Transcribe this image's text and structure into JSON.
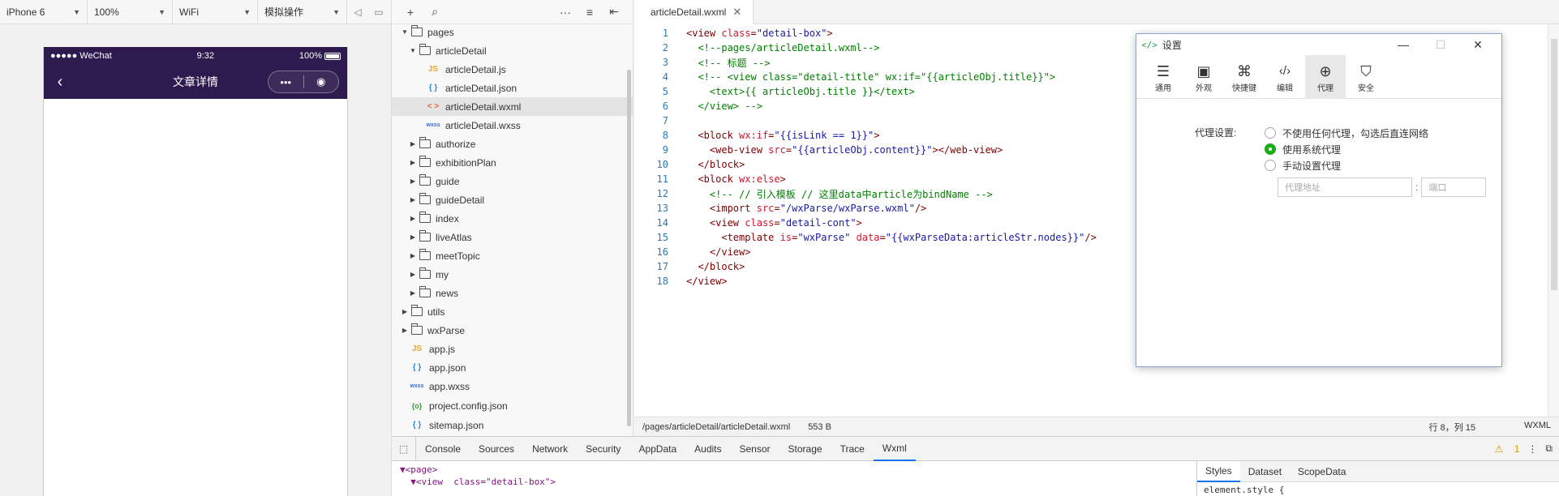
{
  "simulator": {
    "device": "iPhone 6",
    "zoom": "100%",
    "network": "WiFi",
    "mode": "模拟操作",
    "status": {
      "carrier": "●●●●● WeChat",
      "time": "9:32",
      "battery": "100%"
    },
    "nav_title": "文章详情"
  },
  "tree": {
    "rows": [
      {
        "label": "pages"
      },
      {
        "label": "articleDetail"
      },
      {
        "label": "articleDetail.js",
        "icon": "JS"
      },
      {
        "label": "articleDetail.json",
        "icon": "{ }"
      },
      {
        "label": "articleDetail.wxml",
        "icon": "< >"
      },
      {
        "label": "articleDetail.wxss",
        "icon": "wxss"
      },
      {
        "label": "authorize"
      },
      {
        "label": "exhibitionPlan"
      },
      {
        "label": "guide"
      },
      {
        "label": "guideDetail"
      },
      {
        "label": "index"
      },
      {
        "label": "liveAtlas"
      },
      {
        "label": "meetTopic"
      },
      {
        "label": "my"
      },
      {
        "label": "news"
      },
      {
        "label": "utils"
      },
      {
        "label": "wxParse"
      },
      {
        "label": "app.js",
        "icon": "JS"
      },
      {
        "label": "app.json",
        "icon": "{ }"
      },
      {
        "label": "app.wxss",
        "icon": "wxss"
      },
      {
        "label": "project.config.json",
        "icon": "{o}"
      },
      {
        "label": "sitemap.json",
        "icon": "{ }"
      }
    ]
  },
  "editor": {
    "tab": "articleDetail.wxml",
    "status_path": "/pages/articleDetail/articleDetail.wxml",
    "status_size": "553 B",
    "cursor": "行 8，列 15",
    "lang": "WXML",
    "line_numbers": [
      "1",
      "2",
      "3",
      "4",
      "5",
      "6",
      "7",
      "8",
      "9",
      "10",
      "11",
      "12",
      "13",
      "14",
      "15",
      "16",
      "17",
      "18"
    ]
  },
  "dialog": {
    "title": "设置",
    "tabs": [
      {
        "label": "通用",
        "glyph": "☰"
      },
      {
        "label": "外观",
        "glyph": "▣"
      },
      {
        "label": "快捷键",
        "glyph": "⌘"
      },
      {
        "label": "编辑",
        "glyph": "‹/›"
      },
      {
        "label": "代理",
        "glyph": "⊕"
      },
      {
        "label": "安全",
        "glyph": "⛉"
      }
    ],
    "proxy_label": "代理设置:",
    "options": [
      "不使用任何代理，勾选后直连网络",
      "使用系统代理",
      "手动设置代理"
    ],
    "address_placeholder": "代理地址",
    "port_placeholder": "端口"
  },
  "devtools": {
    "tabs": [
      "Console",
      "Sources",
      "Network",
      "Security",
      "AppData",
      "Audits",
      "Sensor",
      "Storage",
      "Trace",
      "Wxml"
    ],
    "warning_count": "1",
    "dom_lines": [
      "▼<page>",
      "  ▼<view  class=\"detail-box\">"
    ],
    "style_tabs": [
      "Styles",
      "Dataset",
      "ScopeData"
    ],
    "element_style": "element.style {"
  }
}
